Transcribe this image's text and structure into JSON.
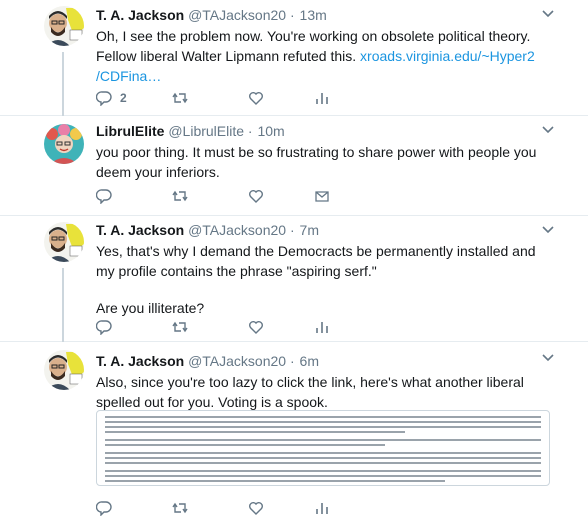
{
  "tweets": [
    {
      "name": "T. A. Jackson",
      "handle": "@TAJackson20",
      "dot": "·",
      "time": "13m",
      "line1": "Oh, I see the problem now. You're working on obsolete political theory.",
      "line2": "Fellow liberal Walter Lipmann refuted this.",
      "link1": "xroads.virginia.edu/~Hyper2",
      "link2": "/CDFina…",
      "reply_count": "2",
      "retweet_count": "",
      "like_count": ""
    },
    {
      "name": "LibrulElite",
      "handle": "@LibrulElite",
      "dot": "·",
      "time": "10m",
      "line1": "you poor thing. It must be so frustrating to share power with people you",
      "line2": "deem your inferiors.",
      "reply_count": "",
      "retweet_count": "",
      "like_count": ""
    },
    {
      "name": "T. A. Jackson",
      "handle": "@TAJackson20",
      "dot": "·",
      "time": "7m",
      "line1": "Yes, that's why I demand the Democracts be permanently installed and",
      "line2": "my profile contains the phrase \"aspiring serf.\"",
      "line3": "Are you illiterate?",
      "reply_count": "",
      "retweet_count": "",
      "like_count": ""
    },
    {
      "name": "T. A. Jackson",
      "handle": "@TAJackson20",
      "dot": "·",
      "time": "6m",
      "line1": "Also, since you're too lazy to click the link, here's what another liberal",
      "line2": "spelled out for you. Voting is a spook.",
      "reply_count": "",
      "retweet_count": "",
      "like_count": ""
    }
  ],
  "icons": {
    "reply": "reply-icon",
    "retweet": "retweet-icon",
    "like": "heart-icon",
    "dm": "envelope-icon",
    "analytics": "analytics-icon",
    "caret": "chevron-down-icon"
  },
  "colors": {
    "link": "#1b95e0",
    "secondary_text": "#657786",
    "divider": "#e6ecf0",
    "thread_line": "#ccd6dd"
  }
}
